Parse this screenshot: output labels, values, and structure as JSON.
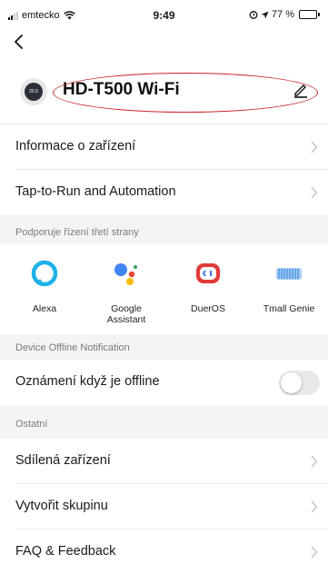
{
  "status_bar": {
    "carrier": "emtecko",
    "time": "9:49",
    "battery_text": "77 %",
    "battery_level": 0.77
  },
  "device": {
    "name": "HD-T500 Wi-Fi",
    "icon_text": "20.5"
  },
  "menu": {
    "info": "Informace o zařízení",
    "tap_to_run": "Tap-to-Run and Automation"
  },
  "third_party": {
    "section_title": "Podporuje řízení třetí strany",
    "platforms": [
      {
        "name": "Alexa",
        "icon": "alexa-icon"
      },
      {
        "name": "Google\nAssistant",
        "icon": "google-assistant-icon"
      },
      {
        "name": "DuerOS",
        "icon": "dueros-icon"
      },
      {
        "name": "Tmall Genie",
        "icon": "tmall-genie-icon"
      }
    ]
  },
  "offline": {
    "section_title": "Device Offline Notification",
    "label": "Oznámení když je offline",
    "enabled": false
  },
  "other": {
    "section_title": "Ostatní",
    "items": [
      "Sdílená zařízení",
      "Vytvořit skupinu",
      "FAQ & Feedback"
    ]
  },
  "colors": {
    "annotation_ellipse": "#c8242c",
    "section_background": "#f4f4f5",
    "alexa_blue": "#1fb1e6",
    "dueros_red": "#e23a3a",
    "tmall_blue": "#3f8fe0"
  }
}
